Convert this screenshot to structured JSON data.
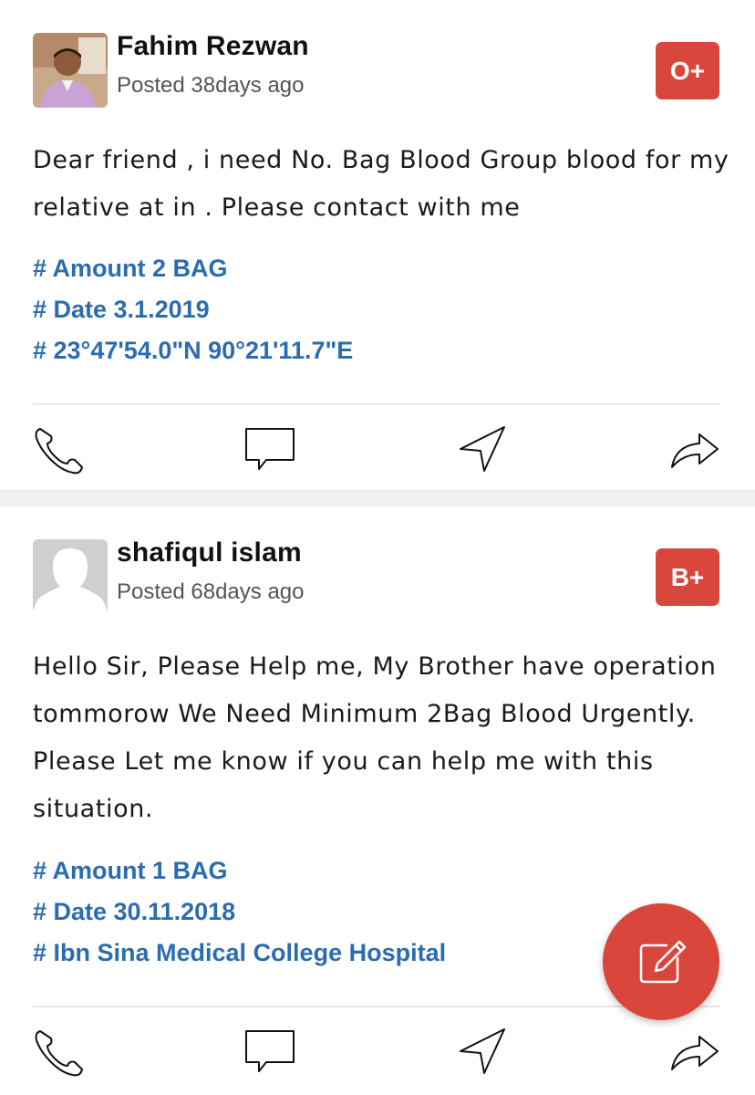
{
  "posts": [
    {
      "author": "Fahim Rezwan",
      "posted": "Posted 38days ago",
      "blood_group": "O+",
      "message": "Dear friend , i need No. Bag Blood Group blood for my relative at  in . Please contact with me",
      "tags": [
        "# Amount 2 BAG",
        "# Date 3.1.2019",
        "# 23°47'54.0\"N 90°21'11.7\"E"
      ],
      "avatar": "photo"
    },
    {
      "author": "shafiqul islam",
      "posted": "Posted 68days ago",
      "blood_group": "B+",
      "message": "Hello Sir, Please Help me, My Brother have operation tommorow We Need Minimum 2Bag Blood Urgently. Please Let me know if you can help me with this situation.",
      "tags": [
        "# Amount 1 BAG",
        "# Date 30.11.2018",
        "# Ibn Sina Medical College Hospital"
      ],
      "avatar": "placeholder"
    }
  ],
  "actions": {
    "icons": [
      "phone-icon",
      "comment-icon",
      "navigation-icon",
      "share-icon"
    ]
  },
  "fab": {
    "icon": "edit-icon"
  },
  "colors": {
    "accent": "#d9473c",
    "tag": "#2b6cb0",
    "background": "#f0f0f0"
  }
}
